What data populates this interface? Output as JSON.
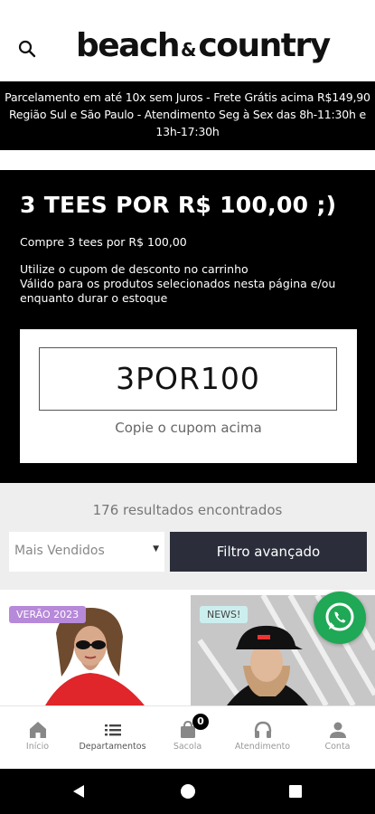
{
  "header": {
    "logo_main": "beach",
    "logo_amp": "&",
    "logo_end": "country",
    "search_icon": "search-icon"
  },
  "announcement": {
    "line1": "Parcelamento em até 10x sem Juros - Frete Grátis acima R$149,90",
    "line2": "Região Sul e São Paulo - Atendimento Seg à Sex das 8h-11:30h e",
    "line3": "13h-17:30h"
  },
  "promo": {
    "title": "3 TEES POR R$ 100,00 ;)",
    "subtitle": "Compre 3 tees por R$ 100,00",
    "desc_line1": "Utilize o cupom de desconto no carrinho",
    "desc_line2": "Válido para os produtos selecionados nesta página e/ou",
    "desc_line3": "enquanto durar o estoque",
    "coupon_code": "3POR100",
    "coupon_hint": "Copie o cupom acima"
  },
  "results": {
    "count_text": "176 resultados encontrados",
    "sort_selected": "Mais Vendidos",
    "filter_label": "Filtro avançado"
  },
  "products": [
    {
      "badge": "VERÃO 2023",
      "badge_color": "#b689d9"
    },
    {
      "badge": "NEWS!",
      "badge_color": "#cdeeee"
    }
  ],
  "whatsapp": {
    "icon": "whatsapp-icon",
    "color": "#1fa855"
  },
  "bottom_nav": {
    "items": [
      {
        "label": "Início",
        "icon": "home-icon"
      },
      {
        "label": "Departamentos",
        "icon": "list-icon"
      },
      {
        "label": "Sacola",
        "icon": "bag-icon",
        "badge": "0"
      },
      {
        "label": "Atendimento",
        "icon": "headset-icon"
      },
      {
        "label": "Conta",
        "icon": "user-icon"
      }
    ]
  },
  "system_nav": {
    "back": "back-icon",
    "home": "home-circle-icon",
    "recents": "recents-icon"
  }
}
